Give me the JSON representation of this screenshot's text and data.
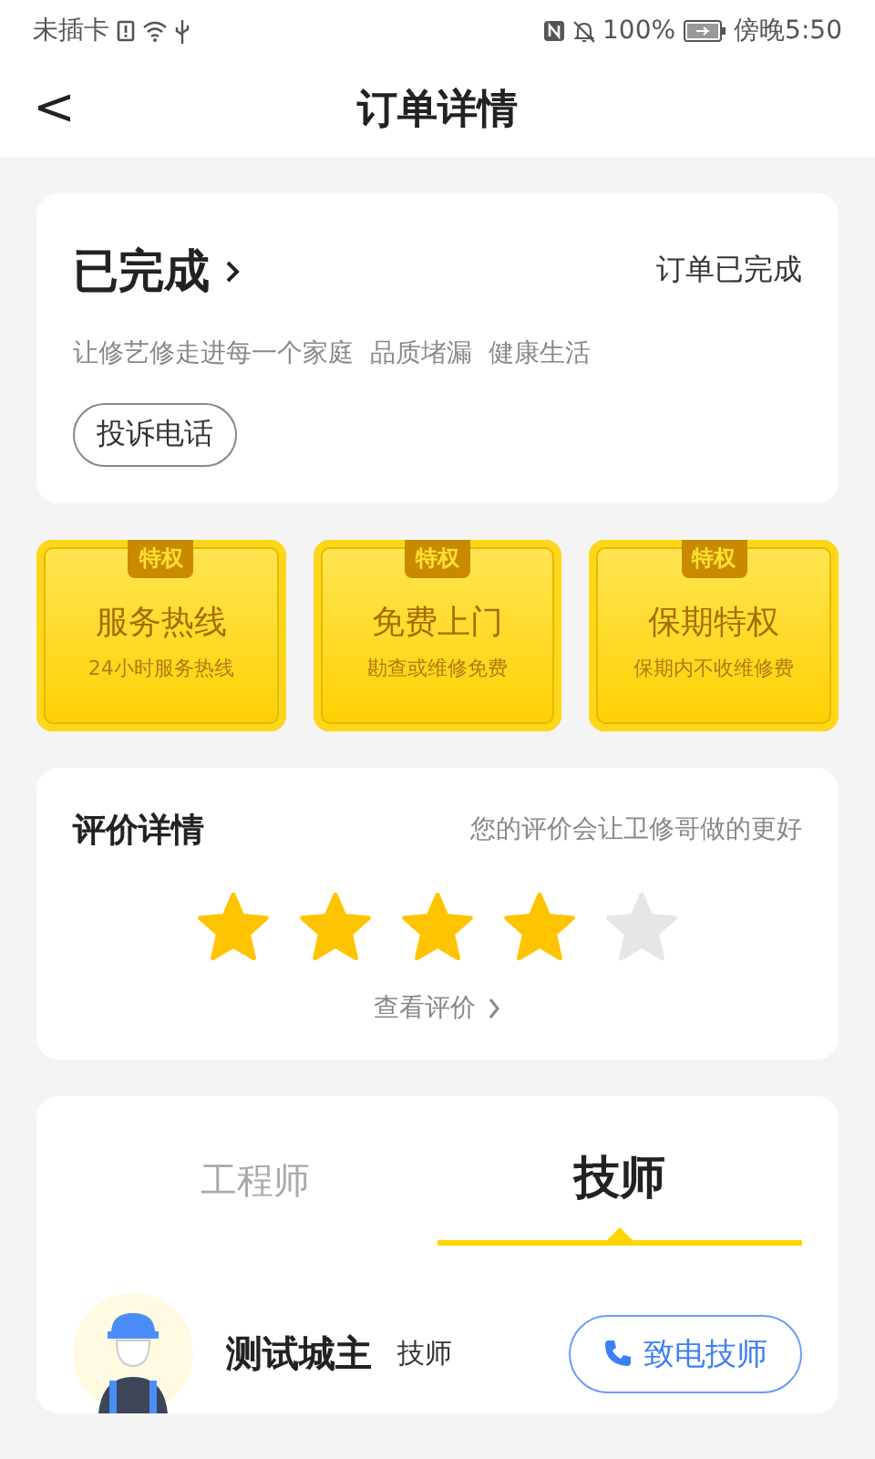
{
  "status_bar": {
    "carrier": "未插卡",
    "battery": "100%",
    "time": "傍晚5:50"
  },
  "header": {
    "back": "<",
    "title": "订单详情"
  },
  "order": {
    "status": "已完成",
    "status_right": "订单已完成",
    "slogan": "让修艺修走进每一个家庭  品质堵漏  健康生活",
    "complaint_button": "投诉电话"
  },
  "perks": [
    {
      "badge": "特权",
      "title": "服务热线",
      "subtitle": "24小时服务热线"
    },
    {
      "badge": "特权",
      "title": "免费上门",
      "subtitle": "勘查或维修免费"
    },
    {
      "badge": "特权",
      "title": "保期特权",
      "subtitle": "保期内不收维修费"
    }
  ],
  "review": {
    "title": "评价详情",
    "hint": "您的评价会让卫修哥做的更好",
    "stars": 4,
    "link": "查看评价"
  },
  "staff": {
    "tabs": [
      {
        "label": "工程师",
        "selected": false
      },
      {
        "label": "技师",
        "selected": true
      }
    ],
    "person": {
      "name": "测试城主",
      "role": "技师",
      "call_button": "致电技师"
    }
  }
}
